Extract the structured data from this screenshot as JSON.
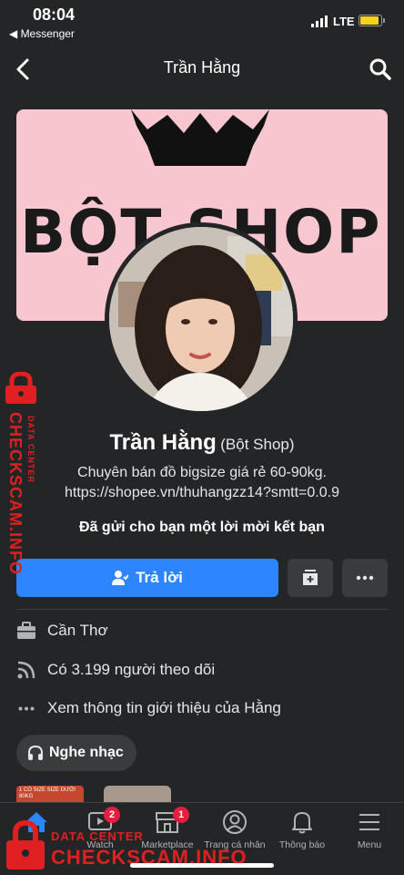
{
  "status_bar": {
    "time": "08:04",
    "back_app": "◀ Messenger",
    "network": "LTE",
    "battery_level": 0.9
  },
  "header": {
    "title": "Trần Hằng"
  },
  "cover": {
    "text": "BỘT SHOP",
    "background": "#f8c6cf"
  },
  "profile": {
    "name": "Trần Hằng",
    "alt_name": "(Bột Shop)",
    "bio_line1": "Chuyên bán đồ bigsize giá rẻ 60-90kg.",
    "bio_line2": "https://shopee.vn/thuhangzz14?smtt=0.0.9",
    "friend_request": "Đã gửi cho bạn một lời mời kết bạn"
  },
  "actions": {
    "reply_label": "Trả lời",
    "accent": "#2d86ff"
  },
  "details": {
    "location": "Cần Thơ",
    "followers": "Có 3.199 người theo dõi",
    "about": "Xem thông tin giới thiệu của Hằng"
  },
  "music_chip": "Nghe nhạc",
  "thumb1_text": "1 CÓ SIZE SIZE DƯỚI 80KG",
  "tabs": [
    {
      "label": "tin",
      "icon": "home-icon"
    },
    {
      "label": "Watch",
      "icon": "watch-icon",
      "badge": "2"
    },
    {
      "label": "Marketplace",
      "icon": "marketplace-icon",
      "badge": "1"
    },
    {
      "label": "Trang cá nhân",
      "icon": "profile-icon"
    },
    {
      "label": "Thông báo",
      "icon": "bell-icon"
    },
    {
      "label": "Menu",
      "icon": "menu-icon"
    }
  ],
  "watermark": {
    "line1": "DATA CENTER",
    "line2": "CHECKSCAM.INFO",
    "color": "#e02020"
  }
}
